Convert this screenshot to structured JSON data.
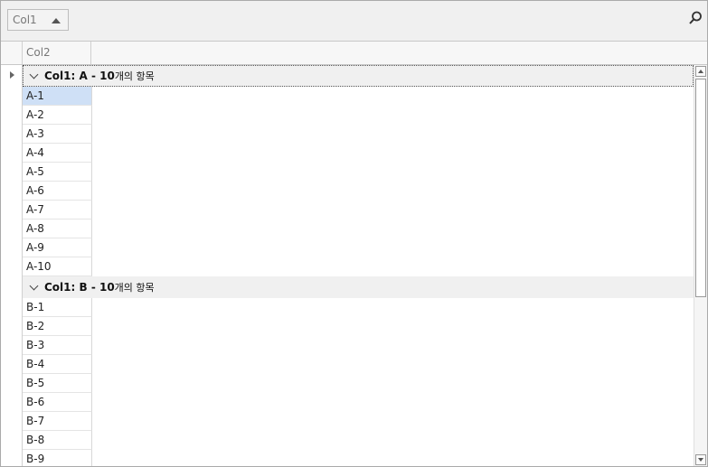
{
  "group_panel": {
    "chip_label": "Col1"
  },
  "header": {
    "column": "Col2"
  },
  "groups": [
    {
      "label": "Col1: A - 10",
      "count": "개의 항목",
      "rows": [
        "A-1",
        "A-2",
        "A-3",
        "A-4",
        "A-5",
        "A-6",
        "A-7",
        "A-8",
        "A-9",
        "A-10"
      ]
    },
    {
      "label": "Col1: B - 10",
      "count": "개의 항목",
      "rows": [
        "B-1",
        "B-2",
        "B-3",
        "B-4",
        "B-5",
        "B-6",
        "B-7",
        "B-8",
        "B-9"
      ]
    }
  ],
  "colors": {
    "selection": "#cfe0f6",
    "group_background": "#f0f0f0"
  },
  "icons": {
    "search": "search-icon",
    "sort": "sort-ascending-icon",
    "expand": "chevron-down-icon",
    "row_indicator": "row-pointer-icon"
  },
  "scroll": {
    "position_fraction": 0.0
  }
}
